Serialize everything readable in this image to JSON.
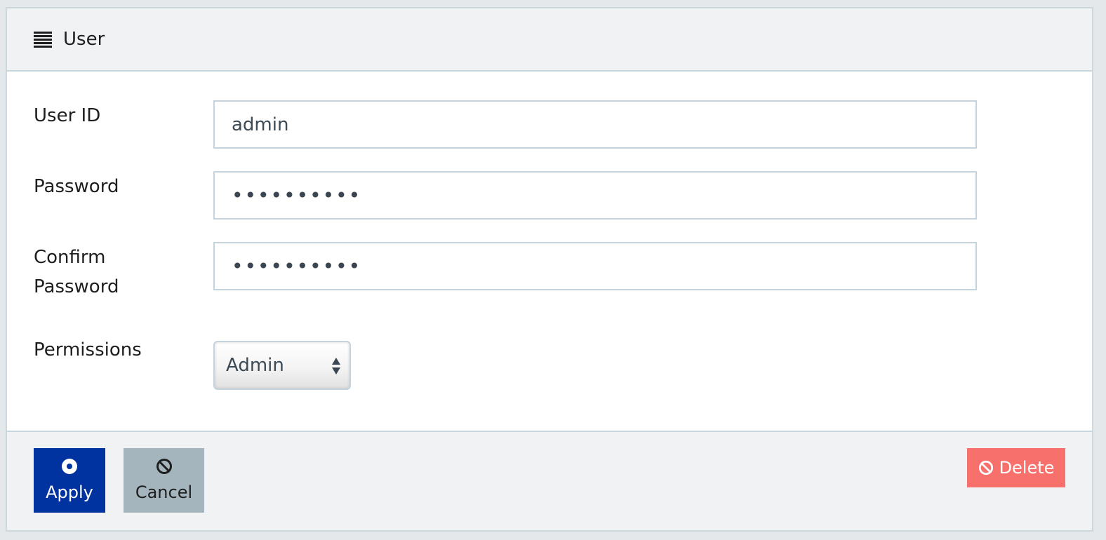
{
  "header": {
    "icon": "list-icon",
    "title": "User"
  },
  "form": {
    "user_id": {
      "label": "User ID",
      "value": "admin"
    },
    "password": {
      "label": "Password",
      "value": "••••••••••"
    },
    "confirm_password": {
      "label_line1": "Confirm",
      "label_line2": "Password",
      "value": "••••••••••"
    },
    "permissions": {
      "label": "Permissions",
      "selected": "Admin"
    }
  },
  "footer": {
    "apply": {
      "icon": "radio-dot-icon",
      "label": "Apply"
    },
    "cancel": {
      "icon": "ban-icon",
      "label": "Cancel"
    },
    "delete": {
      "icon": "ban-icon",
      "label": "Delete"
    }
  },
  "colors": {
    "apply_bg": "#0033a0",
    "cancel_bg": "#a5b5bd",
    "delete_bg": "#f7706c",
    "header_bg": "#f1f2f4",
    "border": "#c7d5de"
  }
}
